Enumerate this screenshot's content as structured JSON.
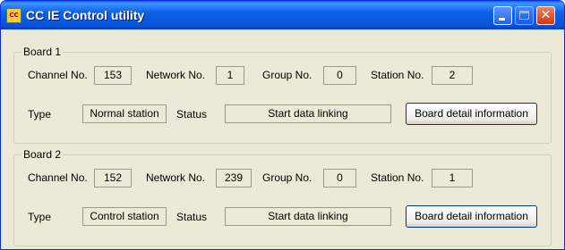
{
  "window": {
    "title": "CC IE Control utility",
    "icon": "cc-ie-app-icon"
  },
  "labels": {
    "channel": "Channel No.",
    "network": "Network No.",
    "group": "Group No.",
    "station": "Station No.",
    "type": "Type",
    "status": "Status"
  },
  "boards": [
    {
      "legend": "Board 1",
      "channel": "153",
      "network": "1",
      "group": "0",
      "station": "2",
      "type": "Normal station",
      "status": "Start data linking",
      "detail_button": "Board detail information"
    },
    {
      "legend": "Board 2",
      "channel": "152",
      "network": "239",
      "group": "0",
      "station": "1",
      "type": "Control station",
      "status": "Start data linking",
      "detail_button": "Board detail information"
    }
  ],
  "colors": {
    "titlebar": "#0553d7",
    "window_bg": "#ece9d8",
    "close_button": "#cc3b14"
  }
}
